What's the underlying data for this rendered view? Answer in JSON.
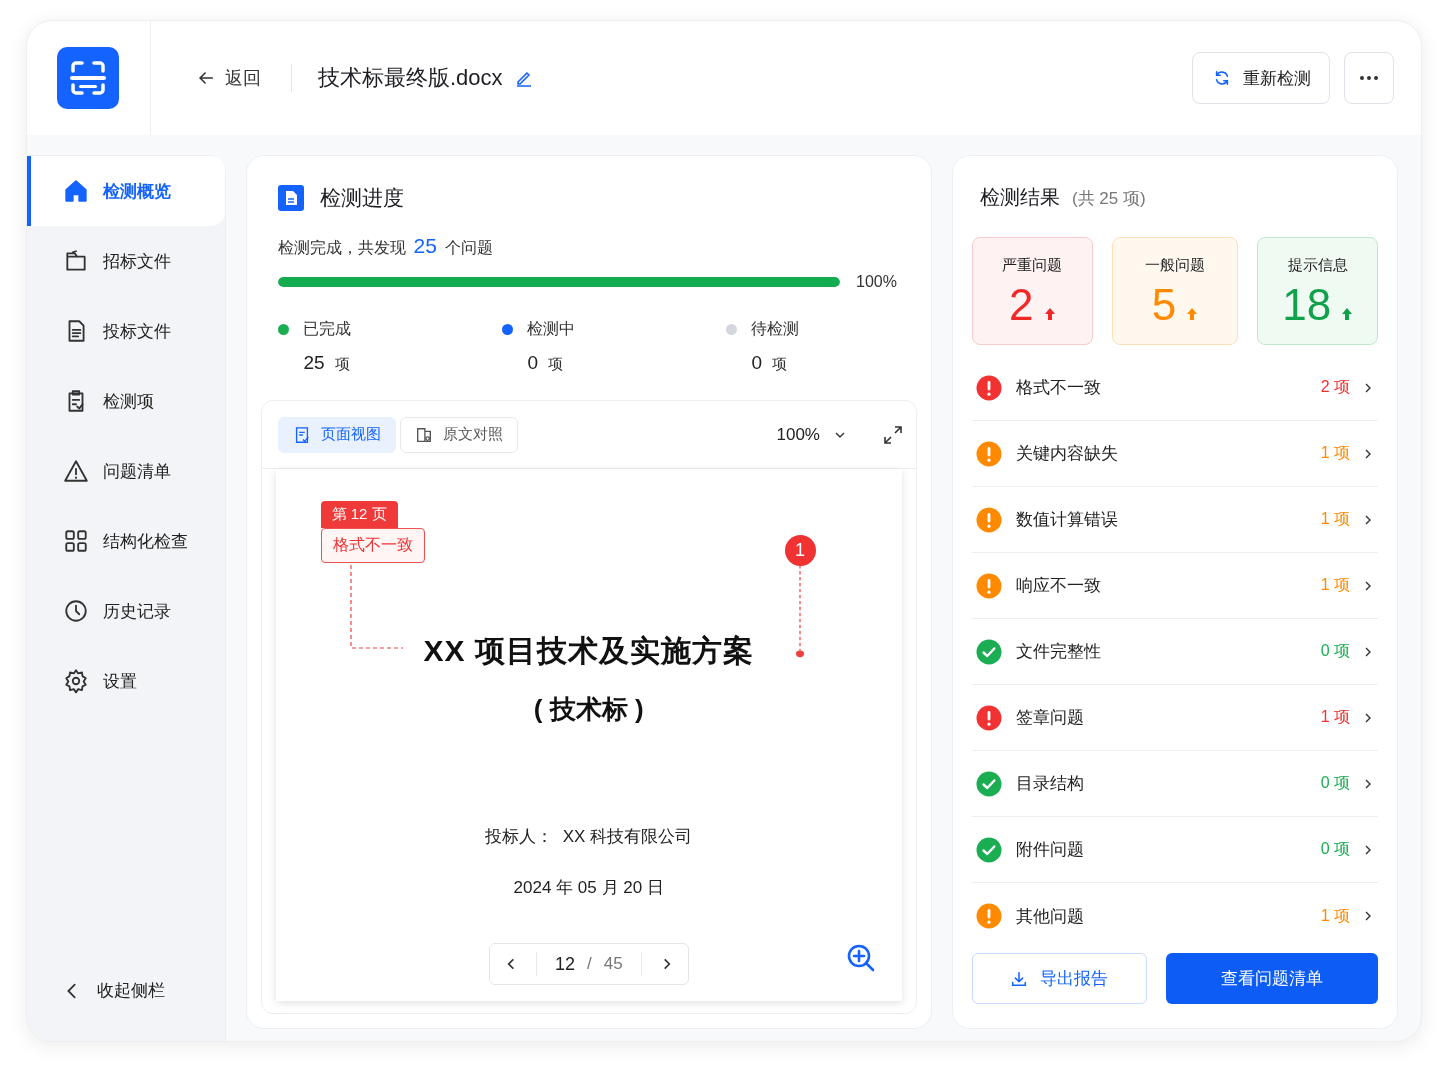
{
  "header": {
    "back": "返回",
    "title": "技术标最终版.docx",
    "recheck": "重新检测"
  },
  "sidebar": {
    "items": [
      {
        "label": "检测概览",
        "selected": true
      },
      {
        "label": "招标文件",
        "selected": false
      },
      {
        "label": "投标文件",
        "selected": false
      },
      {
        "label": "检测项",
        "selected": false
      },
      {
        "label": "问题清单",
        "selected": false
      },
      {
        "label": "结构化检查",
        "selected": false
      },
      {
        "label": "历史记录",
        "selected": false
      },
      {
        "label": "设置",
        "selected": false
      }
    ],
    "collapse": "收起侧栏"
  },
  "progress": {
    "title": "检测进度",
    "summary_before": "检测完成，共发现",
    "count": "25",
    "summary_after": "个问题",
    "level": 1,
    "percent": "100%",
    "legend": [
      {
        "label": "已完成",
        "color": "#1aad52",
        "value": "25",
        "unit": "项"
      },
      {
        "label": "检测中",
        "color": "#1463ff",
        "value": "0",
        "unit": "项"
      },
      {
        "label": "待检测",
        "color": "#d4d7dd",
        "value": "0",
        "unit": "项"
      }
    ]
  },
  "preview": {
    "views": [
      {
        "label": "页面视图",
        "selected": true
      },
      {
        "label": "原文对照",
        "selected": false
      }
    ],
    "zoom": "100%",
    "page_tag": "第 12 页",
    "issue_tag": "格式不一致",
    "marker": "1",
    "doc_title": "XX 项目技术及实施方案",
    "doc_subtitle": "( 技术标 )",
    "bidder": "投标人：  XX 科技有限公司",
    "date": "2024 年 05 月 20 日",
    "pager": {
      "current": "12",
      "separator": "/",
      "total": "45"
    }
  },
  "results": {
    "title": "检测结果",
    "total": "(共 25 项)",
    "cards": [
      {
        "kind": "severe",
        "label": "严重问题",
        "value": "2"
      },
      {
        "kind": "general",
        "label": "一般问题",
        "value": "5"
      },
      {
        "kind": "info",
        "label": "提示信息",
        "value": "18"
      }
    ],
    "rows": [
      {
        "name": "格式不一致",
        "kind": "error",
        "count": "2 项"
      },
      {
        "name": "关键内容缺失",
        "kind": "warning",
        "count": "1 项"
      },
      {
        "name": "数值计算错误",
        "kind": "warning",
        "count": "1 项"
      },
      {
        "name": "响应不一致",
        "kind": "warning",
        "count": "1 项"
      },
      {
        "name": "文件完整性",
        "kind": "ok",
        "count": "0 项"
      },
      {
        "name": "签章问题",
        "kind": "error",
        "count": "1 项"
      },
      {
        "name": "目录结构",
        "kind": "ok",
        "count": "0 项"
      },
      {
        "name": "附件问题",
        "kind": "ok",
        "count": "0 项"
      },
      {
        "name": "其他问题",
        "kind": "warning",
        "count": "1 项"
      }
    ],
    "export": "导出报告",
    "view_list": "查看问题清单"
  }
}
